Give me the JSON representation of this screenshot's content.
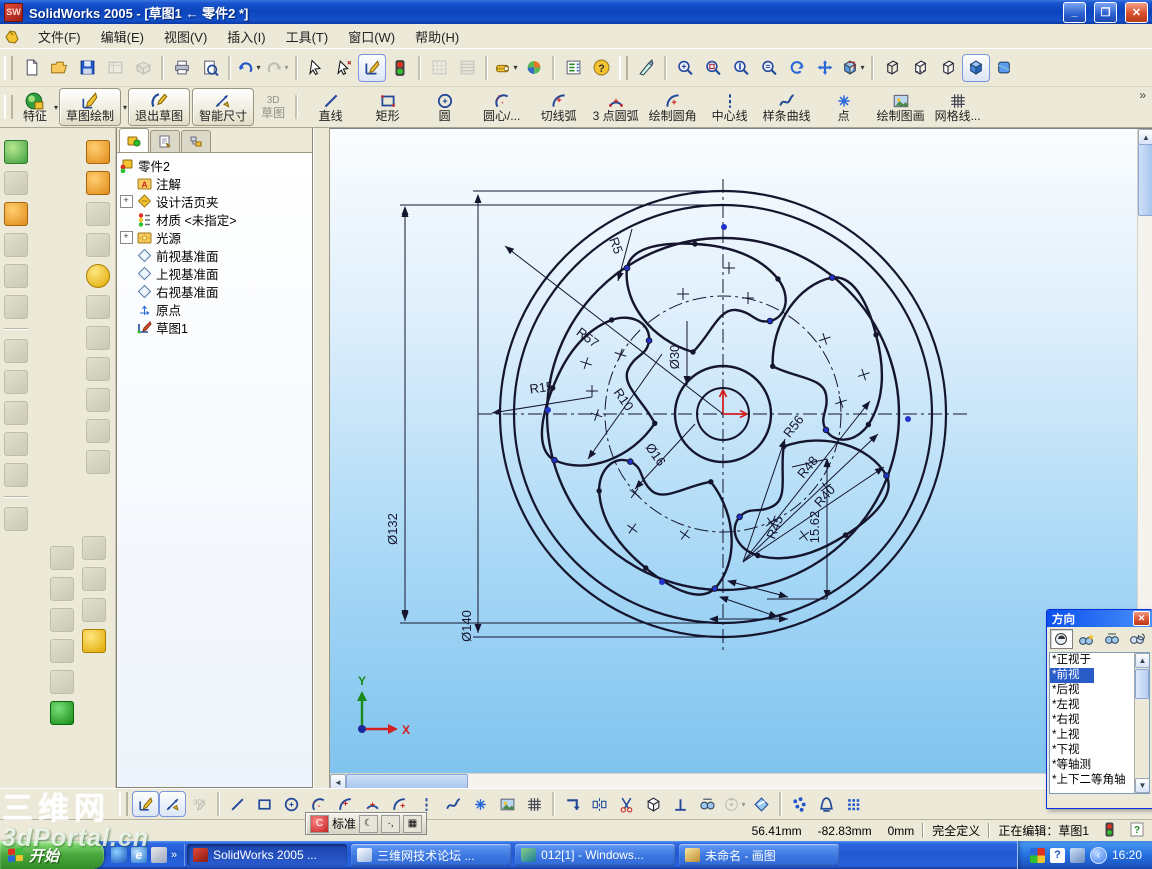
{
  "window": {
    "icon": "solidworks-logo",
    "title": "SolidWorks 2005 - [草图1 ← 零件2 *]",
    "buttons": {
      "minimize": "_",
      "restore": "❐",
      "close": "✕"
    }
  },
  "menu": {
    "items": [
      "文件(F)",
      "编辑(E)",
      "视图(V)",
      "插入(I)",
      "工具(T)",
      "窗口(W)",
      "帮助(H)"
    ]
  },
  "std_toolbar": {
    "icons": [
      "new-document",
      "open",
      "save",
      "make-drawing",
      "make-assembly",
      "print",
      "print-preview",
      "undo",
      "redo",
      "select-arrow",
      "select-other",
      "sketch-toggle",
      "rebuild-traffic-light",
      "grid-a",
      "grid-b",
      "measure",
      "appearance",
      "options",
      "help",
      "previous-view",
      "zoom-fit",
      "zoom-area",
      "zoom-in-out",
      "zoom-selection",
      "rotate-view",
      "pan",
      "standard-views",
      "wireframe",
      "hidden-lines-visible",
      "hidden-lines-removed",
      "shaded",
      "shaded-with-edges"
    ]
  },
  "cmd_toolbar": {
    "feature": "特征",
    "sketch_draw": "草图绘制",
    "exit_sketch": "退出草图",
    "smart_dim": "智能尺寸",
    "d3_prefix": "3D",
    "d3_label": "草图",
    "overflow": "»",
    "tools": [
      {
        "label": "直线",
        "icon": "line"
      },
      {
        "label": "矩形",
        "icon": "rectangle"
      },
      {
        "label": "圆",
        "icon": "circle"
      },
      {
        "label": "圆心/...",
        "icon": "perimeter-circle"
      },
      {
        "label": "切线弧",
        "icon": "tangent-arc"
      },
      {
        "label": "3 点圆弧",
        "icon": "three-point-arc"
      },
      {
        "label": "绘制圆角",
        "icon": "sketch-fillet"
      },
      {
        "label": "中心线",
        "icon": "centerline"
      },
      {
        "label": "样条曲线",
        "icon": "spline"
      },
      {
        "label": "点",
        "icon": "point"
      },
      {
        "label": "绘制图画",
        "icon": "sketch-picture"
      },
      {
        "label": "网格线...",
        "icon": "grid"
      }
    ]
  },
  "tree": {
    "root": "零件2",
    "items": [
      {
        "label": "注解",
        "icon": "annotations-folder",
        "expander": ""
      },
      {
        "label": "设计活页夹",
        "icon": "design-binder",
        "expander": "+"
      },
      {
        "label": "材质 <未指定>",
        "icon": "material",
        "expander": ""
      },
      {
        "label": "光源",
        "icon": "lighting-folder",
        "expander": "+"
      },
      {
        "label": "前视基准面",
        "icon": "plane",
        "expander": ""
      },
      {
        "label": "上视基准面",
        "icon": "plane",
        "expander": ""
      },
      {
        "label": "右视基准面",
        "icon": "plane",
        "expander": ""
      },
      {
        "label": "原点",
        "icon": "origin",
        "expander": ""
      },
      {
        "label": "草图1",
        "icon": "sketch",
        "expander": ""
      }
    ]
  },
  "sketch": {
    "dims": {
      "r5": "R5",
      "r57": "R57",
      "r15": "R15",
      "r10": "R10",
      "d30": "Ø30",
      "d16": "Ø16",
      "r56": "R56",
      "r48": "R48",
      "r40": "R40",
      "r45": "R45",
      "len": "15.62",
      "d132": "Ø132",
      "d140": "Ø140"
    },
    "axes": {
      "x": "X",
      "y": "Y"
    }
  },
  "orientation": {
    "title": "方向",
    "toolbar_icons": [
      "normal-to",
      "new-view",
      "update-standard-views",
      "reset-standard-views"
    ],
    "items": [
      "*正视于",
      "*前视",
      "*后视",
      "*左视",
      "*右视",
      "*上视",
      "*下视",
      "*等轴测",
      "*上下二等角轴"
    ],
    "selected": "*前视"
  },
  "ime_bar": {
    "label": "标准",
    "icons": [
      "ime-logo",
      "ime-moon",
      "ime-punctuation",
      "ime-keyboard"
    ]
  },
  "status": {
    "x": "56.41mm",
    "y": "-82.83mm",
    "z": "0mm",
    "state": "完全定义",
    "editing": "正在编辑：草图1"
  },
  "bottom_toolbar": {
    "icons": [
      "sketch",
      "smart-dimension",
      "3d-sketch",
      "line",
      "rectangle",
      "circle",
      "perimeter-circle",
      "tangent-arc",
      "three-point-arc",
      "arc",
      "centerline",
      "spline",
      "point",
      "sketch-picture",
      "grid",
      "convert-entities",
      "mirror",
      "trim",
      "extrude-preview",
      "perpendicular",
      "dynamic-mirror",
      "circular-pattern",
      "quick-snaps",
      "display-relations",
      "add-relation",
      "linear-pattern"
    ]
  },
  "taskbar": {
    "start": "开始",
    "quick_launch": [
      "msn-icon",
      "internet-explorer-icon",
      "show-desktop-icon"
    ],
    "overflow": "»",
    "buttons": [
      {
        "label": "SolidWorks 2005 ..."
      },
      {
        "label": "三维网技术论坛 ..."
      },
      {
        "label": "012[1] - Windows..."
      },
      {
        "label": "未命名 - 画图"
      }
    ],
    "time": "16:20"
  },
  "watermark": {
    "line1": "三维网",
    "line2": "3dPortal.cn"
  }
}
